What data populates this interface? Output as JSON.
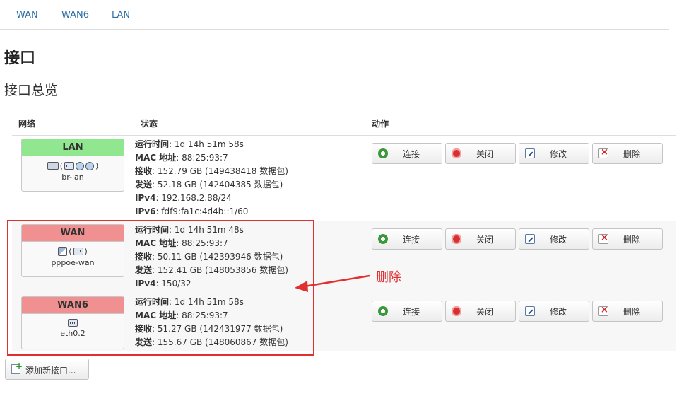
{
  "tabs": [
    "WAN",
    "WAN6",
    "LAN"
  ],
  "page_title": "接口",
  "subtitle": "接口总览",
  "table": {
    "headers": [
      "网络",
      "状态",
      "动作"
    ],
    "rows": [
      {
        "name": "LAN",
        "header_color": "#90e790",
        "icons": [
          "bridge-icon",
          "(",
          "ethernet-icon",
          "wireless-icon",
          "wireless-icon",
          ")"
        ],
        "device": "br-lan",
        "status": [
          {
            "k": "运行时间",
            "v": ": 1d 14h 51m 58s"
          },
          {
            "k": "MAC 地址",
            "v": ": 88:25:93:7"
          },
          {
            "k": "接收",
            "v": ": 152.79 GB (149438418 数据包)"
          },
          {
            "k": "发送",
            "v": ": 52.18 GB (142404385 数据包)"
          },
          {
            "k": "IPv4",
            "v": ": 192.168.2.88/24"
          },
          {
            "k": "IPv6",
            "v": ": fdf9:fa1c:4d4b::1/60"
          }
        ]
      },
      {
        "name": "WAN",
        "header_color": "#f09090",
        "icons": [
          "pppoe-icon",
          "(",
          "ethernet-icon",
          ")"
        ],
        "device": "pppoe-wan",
        "status": [
          {
            "k": "运行时间",
            "v": ": 1d 14h 51m 48s"
          },
          {
            "k": "MAC 地址",
            "v": ": 88:25:93:7"
          },
          {
            "k": "接收",
            "v": ": 50.11 GB (142393946 数据包)"
          },
          {
            "k": "发送",
            "v": ": 152.41 GB (148053856 数据包)"
          },
          {
            "k": "IPv4",
            "v": ": 150/32"
          }
        ]
      },
      {
        "name": "WAN6",
        "header_color": "#f09090",
        "icons": [
          "ethernet-icon"
        ],
        "device": "eth0.2",
        "status": [
          {
            "k": "运行时间",
            "v": ": 1d 14h 51m 58s"
          },
          {
            "k": "MAC 地址",
            "v": ": 88:25:93:7"
          },
          {
            "k": "接收",
            "v": ": 51.27 GB (142431977 数据包)"
          },
          {
            "k": "发送",
            "v": ": 155.67 GB (148060867 数据包)"
          }
        ]
      }
    ]
  },
  "buttons": {
    "connect": "连接",
    "close": "关闭",
    "edit": "修改",
    "delete": "删除"
  },
  "annotation": "删除",
  "add_button": "添加新接口..."
}
